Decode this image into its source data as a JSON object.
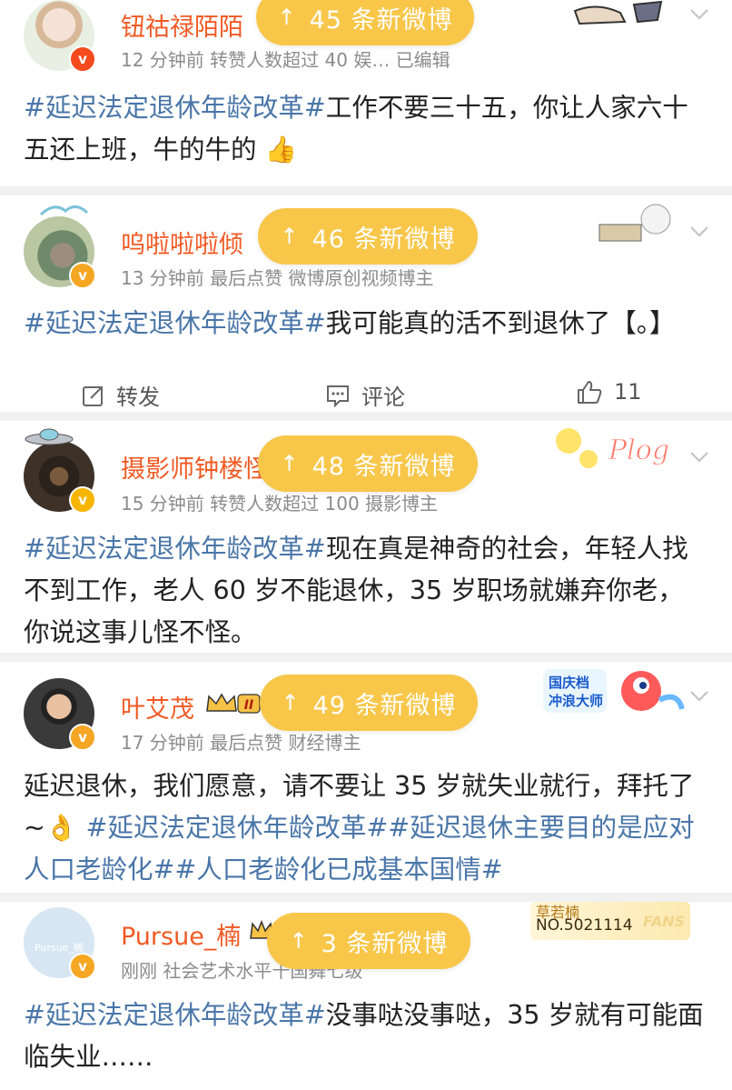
{
  "posts": [
    {
      "name": "钮祜禄陌陌",
      "meta": "12 分钟前  转赞人数超过 40  娱…  已编辑",
      "segments": [
        {
          "text": "#延迟法定退休年龄改革#",
          "tag": true
        },
        {
          "text": "工作不要三十五，你让人家六十五还上班，牛的牛的",
          "tag": false
        }
      ],
      "emoji": "👍",
      "pill": "45 条新微博"
    },
    {
      "name": "呜啦啦啦倾",
      "meta": "13 分钟前  最后点赞  微博原创视频博主",
      "segments": [
        {
          "text": "#延迟法定退休年龄改革#",
          "tag": true
        },
        {
          "text": "我可能真的活不到退休了【。】",
          "tag": false
        }
      ],
      "pill": "46 条新微博",
      "actions": {
        "repost": "转发",
        "comment": "评论",
        "like": "11"
      }
    },
    {
      "name": "摄影师钟楼怪",
      "meta": "15 分钟前  转赞人数超过 100  摄影博主",
      "segments": [
        {
          "text": "#延迟法定退休年龄改革#",
          "tag": true
        },
        {
          "text": "现在真是神奇的社会，年轻人找不到工作，老人 60 岁不能退休，35 岁职场就嫌弃你老，你说这事儿怪不怪。",
          "tag": false
        }
      ],
      "pill": "48 条新微博",
      "sticker": "Plog"
    },
    {
      "name": "叶艾茂",
      "meta": "17 分钟前  最后点赞  财经博主",
      "segments": [
        {
          "text": "延迟退休，我们愿意，请不要让 35 岁就失业就行，拜托了~",
          "tag": false
        },
        {
          "text": "👌 ",
          "tag": false
        },
        {
          "text": "#延迟法定退休年龄改革##延迟退休主要目的是应对人口老龄化##人口老龄化已成基本国情#",
          "tag": true
        }
      ],
      "pill": "49 条新微博",
      "badge_roman": "II",
      "sticker": "国庆档冲浪大师"
    },
    {
      "name": "Pursue_楠",
      "meta": "刚刚  社会艺术水平十国舞七级",
      "segments": [
        {
          "text": "#延迟法定退休年龄改革#",
          "tag": true
        },
        {
          "text": "没事哒没事哒，35 岁就有可能面临失业……",
          "tag": false
        }
      ],
      "pill": "3 条新微博",
      "fan_card": {
        "title": "草若楠",
        "number": "NO.5021114",
        "label": "FANS"
      },
      "avatar_text": "Pursue_楠"
    }
  ],
  "colors": {
    "name": "#f05a24",
    "tag": "#4a76a8",
    "pill": "#f8c74a",
    "meta": "#8c8c8c"
  }
}
